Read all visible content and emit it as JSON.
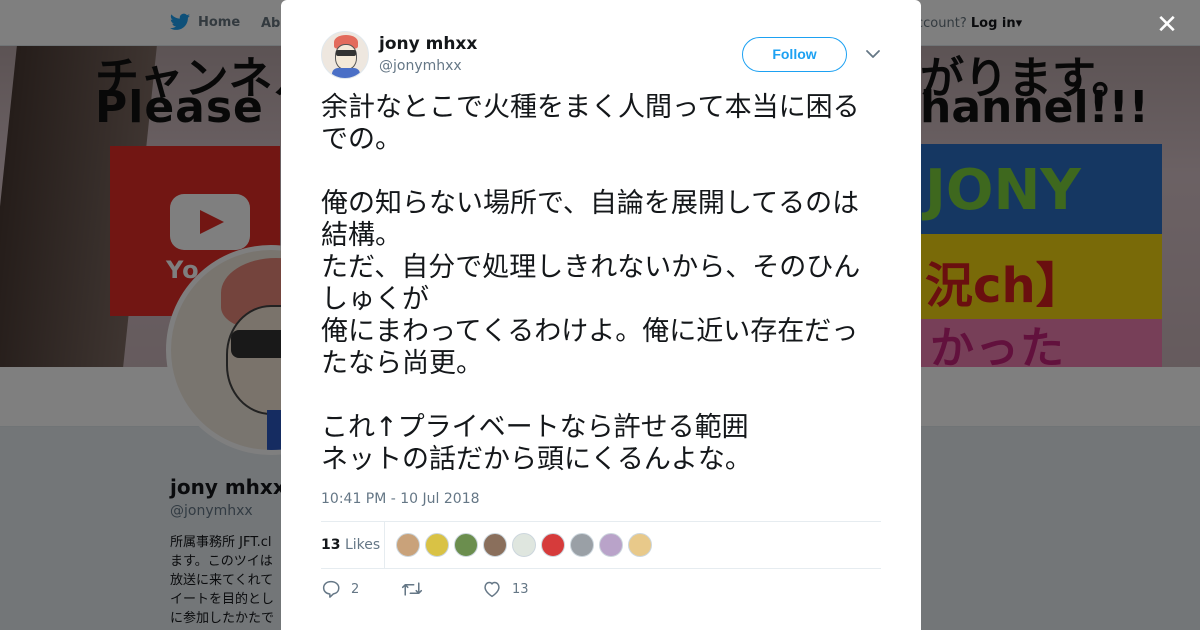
{
  "nav": {
    "home_label": "Home",
    "about_label": "Abo",
    "account_prompt": "ccount?",
    "login_label": "Log in"
  },
  "banner": {
    "line1": "チャンネル",
    "line2": "Please su",
    "channel_text": "hannel!!!",
    "top_right": "がります。",
    "yt_text": "Yo",
    "jony_text": "JONY",
    "ch_text": "況ch】",
    "pink_text": "かった"
  },
  "profile": {
    "name": "jony mhxx",
    "handle": "@jonymhxx",
    "bio": "所属事務所 JFT.cl\nます。このツイは\n放送に来てくれて\nイートを目的とし\nに参加したかたで"
  },
  "tweet": {
    "author_name": "jony mhxx",
    "author_handle": "@jonymhxx",
    "follow_label": "Follow",
    "text": "余計なとこで火種をまく人間って本当に困る\nでの。\n\n俺の知らない場所で、自論を展開してるのは\n結構。\nただ、自分で処理しきれないから、そのひん\nしゅくが\n俺にまわってくるわけよ。俺に近い存在だっ\nたなら尚更。\n\nこれ↑プライベートなら許せる範囲\nネットの話だから頭にくるんよな。",
    "timestamp": "10:41 PM - 10 Jul 2018",
    "likes_count": "13",
    "likes_label": "Likes",
    "replies_count": "2",
    "retweets_count": "",
    "hearts_count": "13"
  },
  "liker_colors": [
    "#c9a27a",
    "#d9c245",
    "#6b8e4e",
    "#8a6f5c",
    "#dfe6df",
    "#d63b3b",
    "#9aa0a6",
    "#b9a3c9",
    "#e8c98a"
  ],
  "colors": {
    "accent": "#1da1f2",
    "text": "#14171a",
    "muted": "#657786"
  }
}
